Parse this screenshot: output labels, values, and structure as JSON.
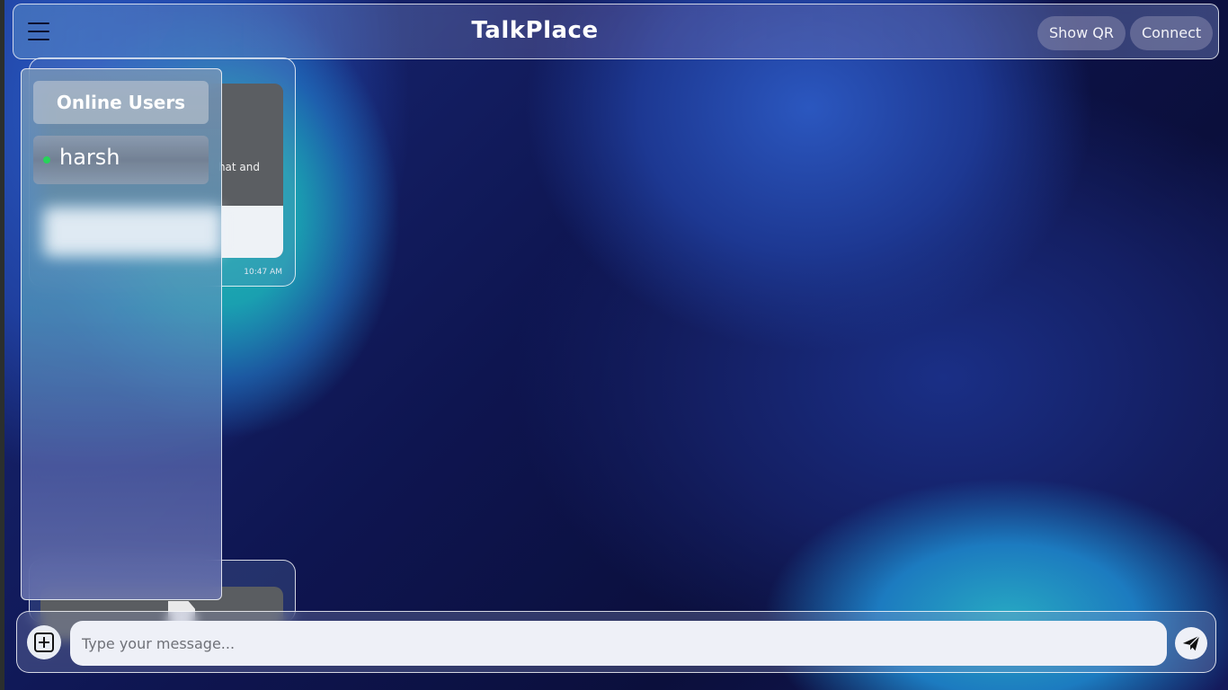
{
  "header": {
    "title": "TalkPlace",
    "menu_icon": "hamburger-menu-icon",
    "show_qr_label": "Show QR",
    "connect_label": "Connect"
  },
  "sidebar": {
    "title": "Online Users",
    "users": [
      {
        "name": "harsh",
        "status": "online",
        "status_color": "#27d35a"
      }
    ]
  },
  "messages": [
    {
      "partial_text": "hat and",
      "time": "10:47 AM"
    },
    {
      "attachment_icon": "file-icon"
    }
  ],
  "composer": {
    "attach_icon": "plus-square-icon",
    "placeholder": "Type your message...",
    "value": "",
    "send_icon": "paper-plane-icon"
  }
}
